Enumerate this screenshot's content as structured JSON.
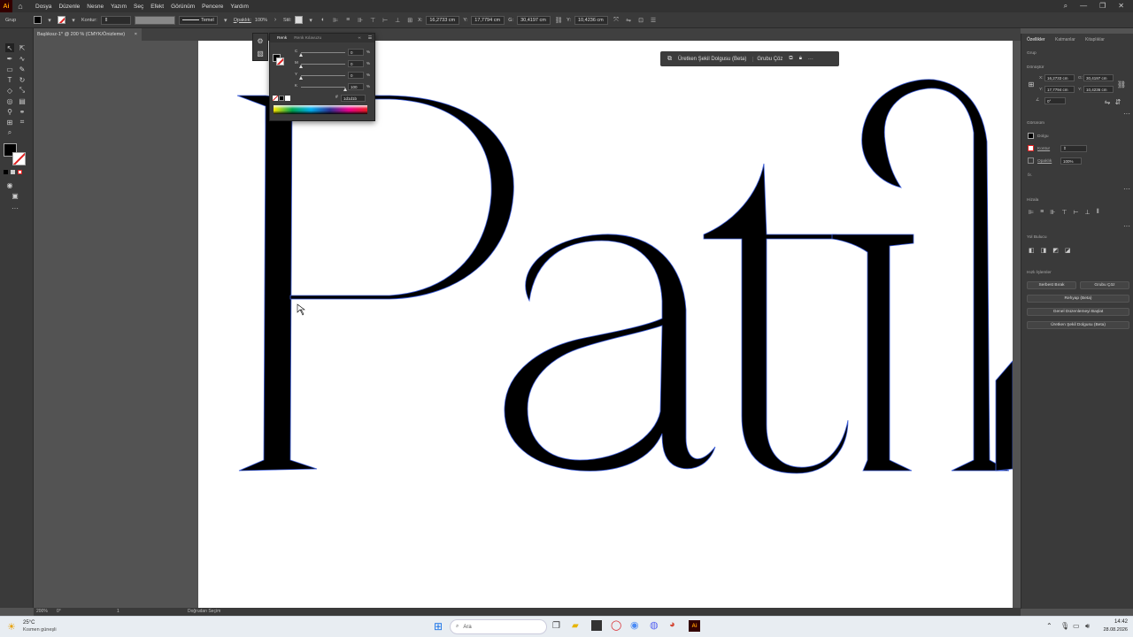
{
  "app": {
    "logo": "Ai"
  },
  "menu": [
    "Dosya",
    "Düzenle",
    "Nesne",
    "Yazım",
    "Seç",
    "Efekt",
    "Görünüm",
    "Pencere",
    "Yardım"
  ],
  "control_bar": {
    "selection": "Grup",
    "stroke_label": "Kontur:",
    "brush": "Temel",
    "opacity_label": "Opaklık:",
    "opacity_value": "100%",
    "style_label": "Stil:",
    "x_label": "X:",
    "x_value": "16,2733 cm",
    "y_label": "Y:",
    "y_value": "17,7794 cm",
    "w_label": "G:",
    "w_value": "30,4197 cm",
    "h_label": "Y:",
    "h_value": "10,4236 cm"
  },
  "document_tab": {
    "title": "Başlıksız-1* @ 200 % (CMYK/Önizleme)",
    "close": "×"
  },
  "color_panel": {
    "tabs": [
      "Renk",
      "Renk Kılavuzu"
    ],
    "channels": [
      {
        "label": "C",
        "value": "0",
        "unit": "%",
        "pos": 0.0
      },
      {
        "label": "M",
        "value": "0",
        "unit": "%",
        "pos": 0.0
      },
      {
        "label": "Y",
        "value": "0",
        "unit": "%",
        "pos": 0.0
      },
      {
        "label": "K",
        "value": "100",
        "unit": "%",
        "pos": 1.0
      }
    ],
    "hex": "1d1d1b",
    "hex_prefix": "#"
  },
  "contextual_bar": {
    "generative_fill": "Üretken Şekil Dolgusu (Beta)",
    "ungroup": "Grubu Çöz",
    "more": "···"
  },
  "canvas": {
    "word": "Patik"
  },
  "right_panel": {
    "tabs": [
      "Özellikler",
      "Katmanlar",
      "Kitaplıklar"
    ],
    "selection": "Grup",
    "transform_title": "Dönüştür",
    "x_label": "X:",
    "x_value": "16,2733 cm",
    "y_label": "Y:",
    "y_value": "17,7794 cm",
    "w_label": "G:",
    "w_value": "30,4197 cm",
    "h_label": "Y:",
    "h_value": "10,4236 cm",
    "angle_value": "0°",
    "appearance_title": "Görünüm",
    "fill_label": "Dolgu",
    "stroke_label": "Kontur",
    "opacity_label": "Opaklık",
    "opacity_value": "100%",
    "fx": "fx.",
    "align_title": "Hizala",
    "pathfinder_title": "Yol Bulucu",
    "quick_actions_title": "Hızlı İşlemler",
    "quick_actions": [
      "Serbest Bırak",
      "Grubu Çöz",
      "Rehyap (Beta)",
      "Genel Düzenlemeyi Başlat",
      "Üretken Şekil Dolgusu (Beta)"
    ]
  },
  "status_bar": {
    "zoom": "200%",
    "rotation": "0°",
    "artboard": "1",
    "tool": "Doğrudan Seçim"
  },
  "taskbar": {
    "weather_temp": "25°C",
    "weather_desc": "Kısmen güneşli",
    "search_placeholder": "Ara",
    "time": "14:42",
    "date": "28.08.2026"
  },
  "colors": {
    "accent": "#ff9a00",
    "ui_dark": "#323232",
    "ui_panel": "#3a3a3a",
    "canvas_bg": "#535353",
    "anchor_blue": "#3b5cd9"
  }
}
